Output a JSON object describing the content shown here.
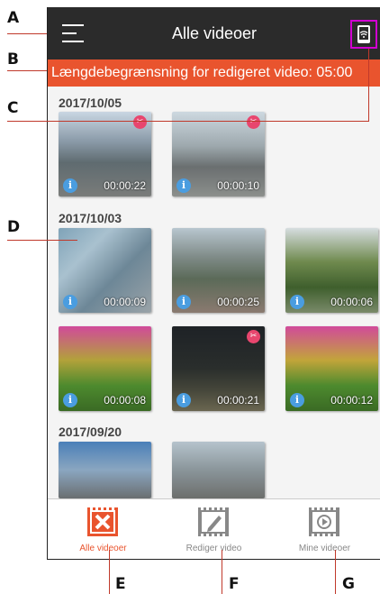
{
  "callouts": {
    "a": "A",
    "b": "B",
    "c": "C",
    "d": "D",
    "e": "E",
    "f": "F",
    "g": "G"
  },
  "header": {
    "title": "Alle videoer"
  },
  "banner": {
    "text": "Længdebegrænsning for redigeret video: 05:00"
  },
  "groups": [
    {
      "date": "2017/10/05",
      "videos": [
        {
          "duration": "00:00:22",
          "edited": true
        },
        {
          "duration": "00:00:10",
          "edited": true
        }
      ]
    },
    {
      "date": "2017/10/03",
      "videos": [
        {
          "duration": "00:00:09",
          "edited": false
        },
        {
          "duration": "00:00:25",
          "edited": false
        },
        {
          "duration": "00:00:06",
          "edited": false
        },
        {
          "duration": "00:00:08",
          "edited": false
        },
        {
          "duration": "00:00:21",
          "edited": true
        },
        {
          "duration": "00:00:12",
          "edited": false
        }
      ]
    },
    {
      "date": "2017/09/20",
      "videos": [
        {
          "duration": "",
          "edited": false
        },
        {
          "duration": "",
          "edited": false
        }
      ]
    }
  ],
  "info_glyph": "i",
  "nav": {
    "all": "Alle videoer",
    "edit": "Rediger video",
    "mine": "Mine videoer"
  },
  "colors": {
    "accent": "#e9542e",
    "topbar": "#2b2b2b",
    "highlight": "#d100d1",
    "info": "#4a9de0",
    "edit_badge": "#e8466e",
    "inactive": "#888888"
  },
  "icons": {
    "menu": "hamburger-icon",
    "device": "wifi-phone-icon",
    "info": "info-icon",
    "edited": "scissors-icon"
  }
}
